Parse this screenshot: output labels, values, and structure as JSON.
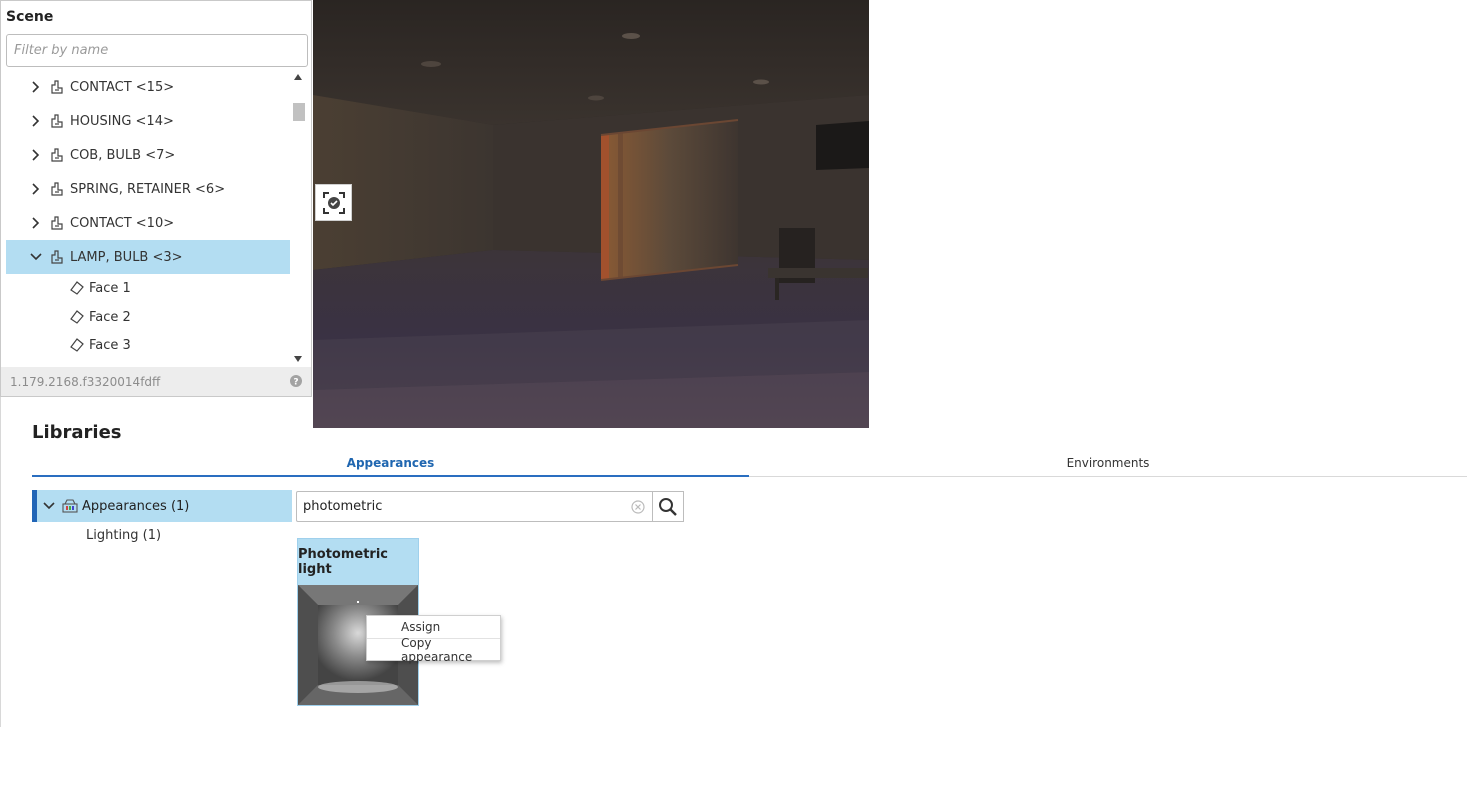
{
  "scene": {
    "title": "Scene",
    "filter_placeholder": "Filter by name",
    "items": [
      {
        "label": "CONTACT <15>",
        "expanded": false
      },
      {
        "label": "HOUSING <14>",
        "expanded": false
      },
      {
        "label": "COB, BULB <7>",
        "expanded": false
      },
      {
        "label": "SPRING, RETAINER <6>",
        "expanded": false
      },
      {
        "label": "CONTACT <10>",
        "expanded": false
      },
      {
        "label": "LAMP, BULB <3>",
        "expanded": true,
        "selected": true
      }
    ],
    "faces": [
      "Face 1",
      "Face 2",
      "Face 3"
    ],
    "version": "1.179.2168.f3320014fdff"
  },
  "libraries": {
    "title": "Libraries",
    "tabs": [
      {
        "label": "Appearances",
        "active": true
      },
      {
        "label": "Environments",
        "active": false
      }
    ],
    "tree_root": "Appearances (1)",
    "tree_child": "Lighting (1)",
    "search_value": "photometric",
    "card_title": "Photometric light",
    "context_menu": {
      "assign": "Assign",
      "copy": "Copy appearance"
    }
  },
  "colors": {
    "selection": "#b3ddf2",
    "accent": "#2165b7",
    "status_bar": "#ededed"
  },
  "icons": {
    "part": "part-icon",
    "face": "face-icon",
    "help": "help-icon",
    "search": "search-icon",
    "clear": "clear-icon",
    "view_toggle": "render-view-icon"
  }
}
